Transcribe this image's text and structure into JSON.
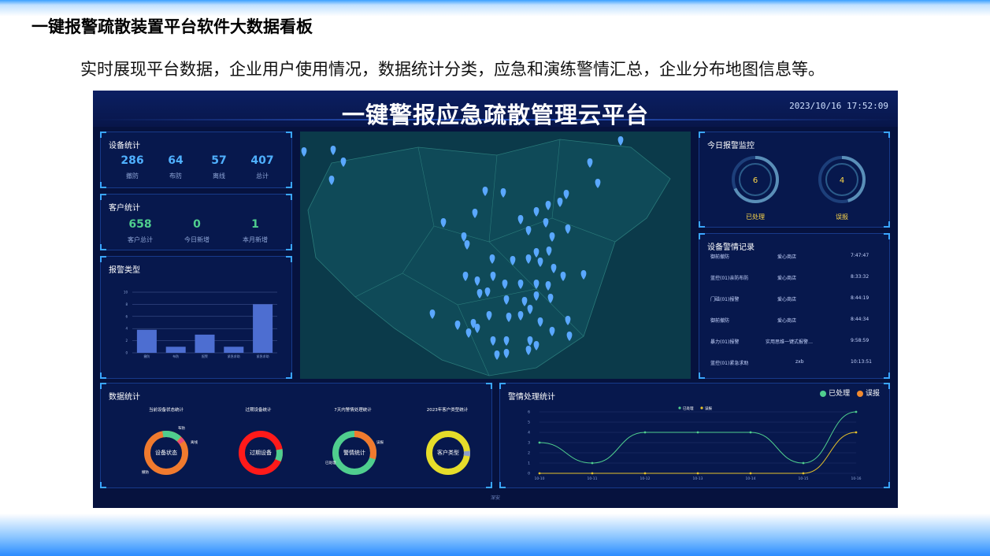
{
  "slide": {
    "title": "一键报警疏散装置平台软件大数据看板",
    "subtitle": "实时展现平台数据，企业用户使用情况，数据统计分类，应急和演练警情汇总，企业分布地图信息等。"
  },
  "dashboard": {
    "title": "一键警报应急疏散管理云平台",
    "datetime": "2023/10/16 17:52:09",
    "footer": "深安"
  },
  "device_stats": {
    "title": "设备统计",
    "items": [
      {
        "value": "286",
        "label": "撤防"
      },
      {
        "value": "64",
        "label": "布防"
      },
      {
        "value": "57",
        "label": "离线"
      },
      {
        "value": "407",
        "label": "总计"
      }
    ]
  },
  "customer_stats": {
    "title": "客户统计",
    "items": [
      {
        "value": "658",
        "label": "客户总计"
      },
      {
        "value": "0",
        "label": "今日新增"
      },
      {
        "value": "1",
        "label": "本月新增"
      }
    ]
  },
  "alarm_types": {
    "title": "报警类型"
  },
  "today_alarm": {
    "title": "今日报警监控",
    "gauges": [
      {
        "value": "6",
        "label": "已处理"
      },
      {
        "value": "4",
        "label": "误报"
      }
    ]
  },
  "records": {
    "title": "设备警情记录",
    "rows": [
      {
        "type": "御前撤防",
        "place": "爱心商店",
        "time": "7:47:47"
      },
      {
        "type": "蓝控(01)亲防布防",
        "place": "爱心商店",
        "time": "8:33:32"
      },
      {
        "type": "门磁(01)报警",
        "place": "爱心商店",
        "time": "8:44:19"
      },
      {
        "type": "御前撤防",
        "place": "爱心商店",
        "time": "8:44:34"
      },
      {
        "type": "暴力(01)报警",
        "place": "实用思维一键式报警…",
        "time": "9:58:59"
      },
      {
        "type": "蓝控(01)紧急求助",
        "place": "zxb",
        "time": "10:13:51"
      }
    ]
  },
  "data_stats": {
    "title": "数据统计",
    "donuts": [
      {
        "title": "当前设备状态统计",
        "center": "设备状态",
        "labels": [
          "布防",
          "离线",
          "撤防"
        ]
      },
      {
        "title": "过期设备统计",
        "center": "过期设备",
        "labels": []
      },
      {
        "title": "7天内警情处理统计",
        "center": "警情统计",
        "labels": [
          "误报",
          "已处理"
        ]
      },
      {
        "title": "2023年客户类型统计",
        "center": "客户类型",
        "labels": []
      }
    ]
  },
  "handling": {
    "title": "警情处理统计",
    "legend": [
      "已处理",
      "误报"
    ],
    "mini_legend": [
      "已处理",
      "误报"
    ],
    "colors": {
      "handled": "#4fce8e",
      "false": "#f28a2e"
    }
  },
  "chart_data": [
    {
      "type": "bar",
      "categories": [
        "撤防",
        "布防",
        "报警",
        "紧急求助",
        "紧急求助"
      ],
      "values": [
        3.8,
        1,
        3,
        1,
        8
      ],
      "ylim": [
        0,
        10
      ],
      "grid": true,
      "color": "#4d6ed1"
    },
    {
      "type": "line",
      "x": [
        "10-10",
        "10-11",
        "10-12",
        "10-13",
        "10-14",
        "10-15",
        "10-16"
      ],
      "series": [
        {
          "name": "已处理",
          "values": [
            3,
            1,
            4,
            4,
            4,
            1,
            6
          ]
        },
        {
          "name": "误报",
          "values": [
            0,
            0,
            0,
            0,
            0,
            0,
            4
          ]
        }
      ],
      "ylim": [
        0,
        6
      ],
      "yticks": [
        0,
        1,
        2,
        3,
        4,
        5,
        6
      ],
      "grid": true
    }
  ]
}
